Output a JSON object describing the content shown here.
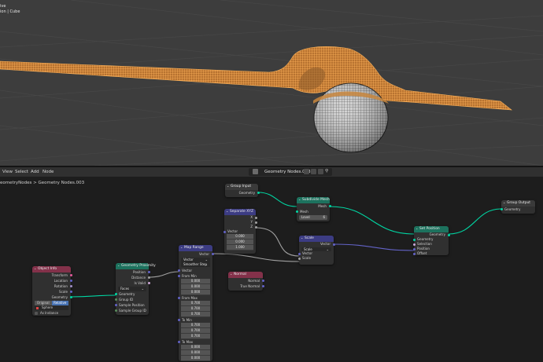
{
  "viewport": {
    "overlay_line1": "ive",
    "overlay_line2": "ion | Cube",
    "colors": {
      "background": "#3d3d3d",
      "wire": "#f0a040",
      "sphere": "#d9d9d9"
    }
  },
  "editor": {
    "menu": [
      "View",
      "Select",
      "Add",
      "Node"
    ],
    "node_tree_name": "Geometry Nodes.003",
    "breadcrumb": "eometryNodes  >  Geometry Nodes.003"
  },
  "nodes": {
    "group_input": {
      "title": "Group Input",
      "geometry": "Geometry"
    },
    "separate_xyz": {
      "title": "Separate XYZ",
      "x": "X",
      "y": "Y",
      "z": "Z",
      "vector": "Vector",
      "v1": "0.000",
      "v2": "0.000",
      "v3": "1.000"
    },
    "subdivide_mesh": {
      "title": "Subdivide Mesh",
      "mesh": "Mesh",
      "mesh_in": "Mesh",
      "level_label": "Level",
      "level_value": "6"
    },
    "group_output": {
      "title": "Group Output",
      "geometry": "Geometry"
    },
    "set_position": {
      "title": "Set Position",
      "geometry_out": "Geometry",
      "geometry": "Geometry",
      "selection": "Selection",
      "position": "Position",
      "offset": "Offset"
    },
    "scale": {
      "title": "Scale",
      "vector_out": "Vector",
      "scale_mode": "Scale",
      "vector": "Vector",
      "scale": "Scale"
    },
    "map_range": {
      "title": "Map Range",
      "vector_out": "Vector",
      "type": "Vector",
      "interp": "Smoother Step",
      "vector": "Vector",
      "from_min": "From Min",
      "fmin": [
        "0.000",
        "0.000",
        "0.000"
      ],
      "from_max": "From Max",
      "fmax": [
        "0.700",
        "0.700",
        "0.700"
      ],
      "to_min": "To Min",
      "tmin": [
        "0.700",
        "0.700",
        "0.700"
      ],
      "to_max": "To Max",
      "tmax": [
        "0.000",
        "0.000",
        "0.000"
      ]
    },
    "normal": {
      "title": "Normal",
      "normal": "Normal",
      "true_normal": "True Normal"
    },
    "geometry_proximity": {
      "title": "Geometry Proximity",
      "position": "Position",
      "distance": "Distance",
      "is_valid": "Is Valid",
      "target": "Faces",
      "geometry": "Geometry",
      "group_id": "Group ID",
      "sample_position": "Sample Position",
      "sample_group_id": "Sample Group ID"
    },
    "object_info": {
      "title": "Object Info",
      "transform": "Transform",
      "location": "Location",
      "rotation": "Rotation",
      "scale": "Scale",
      "geometry": "Geometry",
      "mode_original": "Original",
      "mode_relative": "Relative",
      "object": "Sphere",
      "as_instance": "As Instance"
    }
  },
  "colors": {
    "geometry_socket": "#00d6a3",
    "vector_socket": "#6363c7",
    "float_socket": "#a1a1a1",
    "header_input": "#83314a",
    "header_geometry": "#1d725e",
    "header_vector": "#3c3c83",
    "header_utility": "#3a3a3a"
  }
}
